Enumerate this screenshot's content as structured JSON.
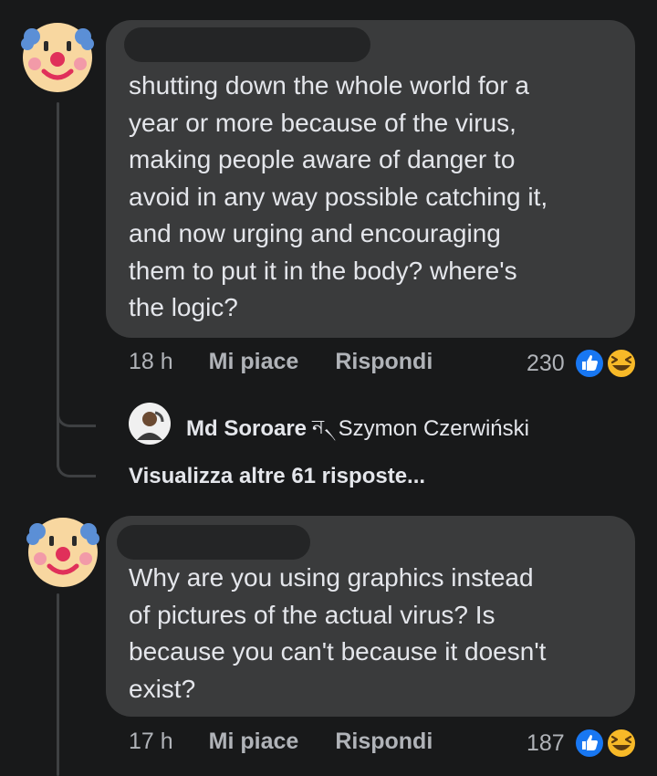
{
  "comments": [
    {
      "text": "shutting down the whole world for a\nyear or more because of the virus,\nmaking people aware of danger to\navoid in any way possible catching it,\nand now urging and encouraging\nthem to put it in the body? where's\nthe logic?",
      "time": "18 h",
      "like_label": "Mi piace",
      "reply_label": "Rispondi",
      "reaction_count": "230",
      "reactions": [
        "like-icon",
        "laugh-icon"
      ],
      "avatar": "clown-face-icon"
    },
    {
      "text": "Why are you using graphics instead\nof pictures of the actual virus? Is\nbecause you can't because it doesn't\nexist?",
      "time": "17 h",
      "like_label": "Mi piace",
      "reply_label": "Rispondi",
      "reaction_count": "187",
      "reactions": [
        "like-icon",
        "laugh-icon"
      ],
      "avatar": "clown-face-icon"
    }
  ],
  "reply_preview": {
    "author": "Md Soroare",
    "reply_glyph": "ন৲",
    "text": "Szymon Czerwiński"
  },
  "more_replies_label": "Visualizza altre 61 risposte...",
  "colors": {
    "background": "#18191a",
    "bubble": "#3a3b3c",
    "like_blue": "#1877f2",
    "laugh_yellow": "#f7b928"
  }
}
